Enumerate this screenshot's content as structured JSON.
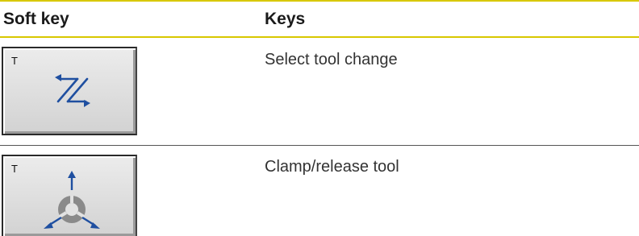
{
  "table": {
    "headers": {
      "softkey": "Soft key",
      "keys": "Keys"
    },
    "rows": [
      {
        "softkey_label": "T",
        "softkey_icon": "tool-change-arrows-icon",
        "description": "Select tool change"
      },
      {
        "softkey_label": "T",
        "softkey_icon": "clamp-release-tool-icon",
        "description": "Clamp/release tool"
      }
    ]
  },
  "colors": {
    "header_rule": "#d8c800",
    "icon_blue": "#1f4fa0",
    "chuck_gray": "#8a8a8a"
  }
}
